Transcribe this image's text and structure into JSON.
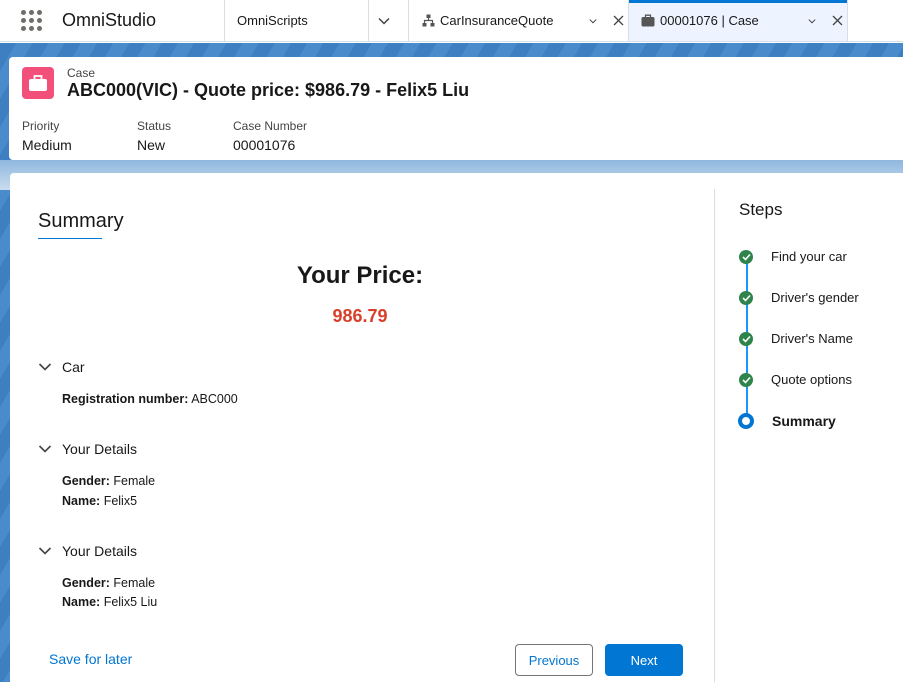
{
  "topnav": {
    "app_name": "OmniStudio",
    "nav_item": "OmniScripts",
    "workspace_tabs": [
      {
        "label": "CarInsuranceQuote",
        "icon": "hierarchy-icon"
      },
      {
        "label": "00001076 | Case",
        "icon": "briefcase-icon"
      }
    ]
  },
  "record": {
    "object_type": "Case",
    "title": "ABC000(VIC) - Quote price: $986.79 - Felix5 Liu",
    "fields": [
      {
        "label": "Priority",
        "value": "Medium"
      },
      {
        "label": "Status",
        "value": "New"
      },
      {
        "label": "Case Number",
        "value": "00001076"
      }
    ],
    "icon_color": "#f2507b"
  },
  "summary": {
    "title": "Summary",
    "price_heading": "Your Price:",
    "price_value": "986.79",
    "price_color": "#d9402b",
    "sections": [
      {
        "title": "Car",
        "rows": [
          {
            "key": "Registration number:",
            "value": " ABC000"
          }
        ]
      },
      {
        "title": "Your Details",
        "rows": [
          {
            "key": "Gender:",
            "value": " Female"
          },
          {
            "key": "Name:",
            "value": " Felix5"
          }
        ]
      },
      {
        "title": "Your Details",
        "rows": [
          {
            "key": "Gender:",
            "value": " Female"
          },
          {
            "key": "Name:",
            "value": " Felix5 Liu"
          }
        ]
      }
    ],
    "save_for_later": "Save for later",
    "previous_label": "Previous",
    "next_label": "Next"
  },
  "steps": {
    "title": "Steps",
    "items": [
      {
        "label": "Find your car",
        "state": "complete"
      },
      {
        "label": "Driver's gender",
        "state": "complete"
      },
      {
        "label": "Driver's Name",
        "state": "complete"
      },
      {
        "label": "Quote options",
        "state": "complete"
      },
      {
        "label": "Summary",
        "state": "current"
      }
    ]
  },
  "colors": {
    "brand": "#0176d3",
    "complete": "#2e844a"
  }
}
